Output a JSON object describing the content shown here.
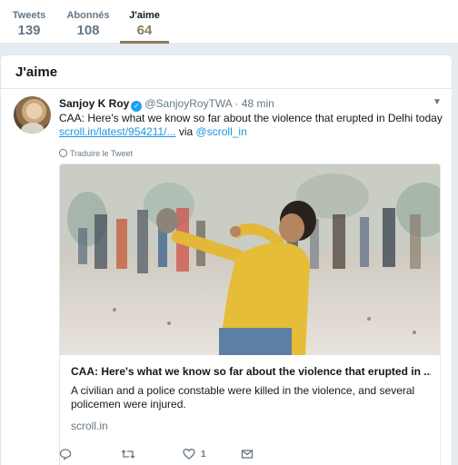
{
  "stats": [
    {
      "label": "Tweets",
      "value": "139"
    },
    {
      "label": "Abonnés",
      "value": "108"
    },
    {
      "label": "J'aime",
      "value": "64"
    }
  ],
  "section": {
    "title": "J'aime"
  },
  "tweet": {
    "author_name": "Sanjoy K Roy",
    "handle": "@SanjoyRoyTWA",
    "separator": "·",
    "time": "48 min",
    "text": "CAA: Here's what we know so far about the violence that erupted in Delhi today",
    "link": "scroll.in/latest/954211/...",
    "via": "via",
    "mention": "@scroll_in",
    "translate": "Traduire le Tweet",
    "card": {
      "headline": "CAA: Here's what we know so far about the violence that erupted in ...",
      "description": "A civilian and a police constable were killed in the violence, and several policemen were injured.",
      "domain": "scroll.in"
    },
    "actions": {
      "like_count": "1"
    }
  },
  "colors": {
    "accent": "#8a7b5b",
    "link": "#1b95e0",
    "verified": "#1da1f2"
  }
}
